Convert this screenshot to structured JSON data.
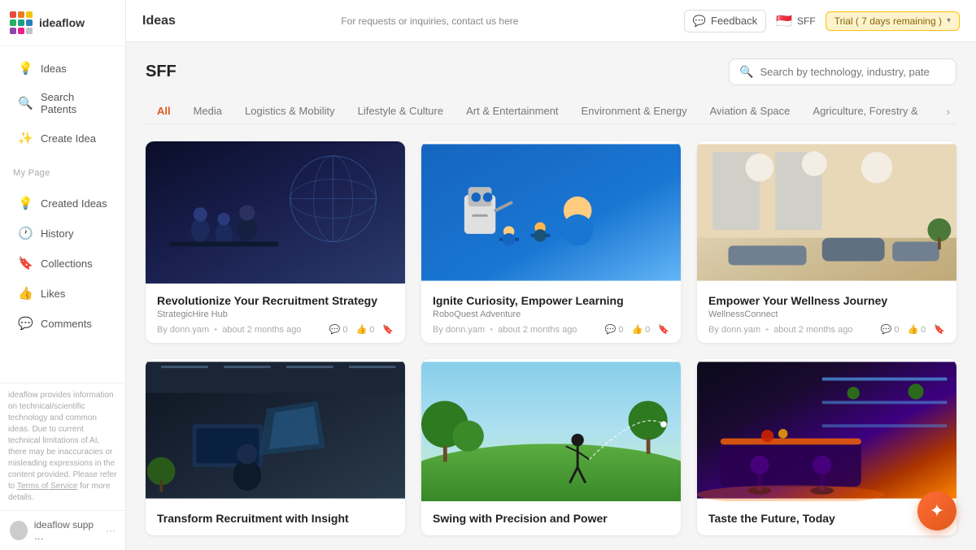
{
  "sidebar": {
    "logo_text": "ideaflow",
    "nav_items": [
      {
        "id": "ideas",
        "label": "Ideas",
        "icon": "💡"
      },
      {
        "id": "search-patents",
        "label": "Search Patents",
        "icon": "🔍"
      },
      {
        "id": "create-idea",
        "label": "Create Idea",
        "icon": "✨"
      }
    ],
    "my_page_label": "My Page",
    "my_page_items": [
      {
        "id": "created-ideas",
        "label": "Created Ideas",
        "icon": "💡"
      },
      {
        "id": "history",
        "label": "History",
        "icon": "🕐"
      },
      {
        "id": "collections",
        "label": "Collections",
        "icon": "🔖"
      },
      {
        "id": "likes",
        "label": "Likes",
        "icon": "👍"
      },
      {
        "id": "comments",
        "label": "Comments",
        "icon": "💬"
      }
    ],
    "footer_text": "ideaflow provides information on technical/scientific technology and common ideas. Due to current technical limitations of AI, there may be inaccuracies or misleading expressions in the content provided. Please refer to Terms of Service for more details.",
    "terms_link": "Terms of Service",
    "user_name": "ideaflow supp …",
    "user_more": "···"
  },
  "topbar": {
    "title": "Ideas",
    "center_text": "For requests or inquiries, contact us here",
    "feedback_label": "Feedback",
    "org_code": "SFF",
    "trial_label": "Trial ( 7 days remaining )"
  },
  "content": {
    "page_title": "SFF",
    "search_placeholder": "Search by technology, industry, pate",
    "tabs": [
      {
        "id": "all",
        "label": "All",
        "active": true
      },
      {
        "id": "media",
        "label": "Media"
      },
      {
        "id": "logistics",
        "label": "Logistics & Mobility"
      },
      {
        "id": "lifestyle",
        "label": "Lifestyle & Culture"
      },
      {
        "id": "art",
        "label": "Art & Entertainment"
      },
      {
        "id": "environment",
        "label": "Environment & Energy"
      },
      {
        "id": "aviation",
        "label": "Aviation & Space"
      },
      {
        "id": "agriculture",
        "label": "Agriculture, Forestry &"
      }
    ],
    "cards": [
      {
        "id": "card-1",
        "title": "Revolutionize Your Recruitment Strategy",
        "subtitle": "StrategicHire Hub",
        "comments": "0",
        "likes": "0",
        "author": "By donn.yam",
        "time": "about 2 months ago",
        "img_class": "scene-office"
      },
      {
        "id": "card-2",
        "title": "Ignite Curiosity, Empower Learning",
        "subtitle": "RoboQuest Adventure",
        "comments": "0",
        "likes": "0",
        "author": "By donn.yam",
        "time": "about 2 months ago",
        "img_class": "scene-classroom"
      },
      {
        "id": "card-3",
        "title": "Empower Your Wellness Journey",
        "subtitle": "WellnessConnect",
        "comments": "0",
        "likes": "0",
        "author": "By donn.yam",
        "time": "about 2 months ago",
        "img_class": "scene-wellness"
      },
      {
        "id": "card-4",
        "title": "Transform Recruitment with Insight",
        "subtitle": "",
        "comments": "",
        "likes": "",
        "author": "",
        "time": "",
        "img_class": "scene-techoffice"
      },
      {
        "id": "card-5",
        "title": "Swing with Precision and Power",
        "subtitle": "",
        "comments": "",
        "likes": "",
        "author": "",
        "time": "",
        "img_class": "scene-golf"
      },
      {
        "id": "card-6",
        "title": "Taste the Future, Today",
        "subtitle": "",
        "comments": "",
        "likes": "",
        "author": "",
        "time": "",
        "img_class": "scene-kitchen"
      }
    ]
  }
}
